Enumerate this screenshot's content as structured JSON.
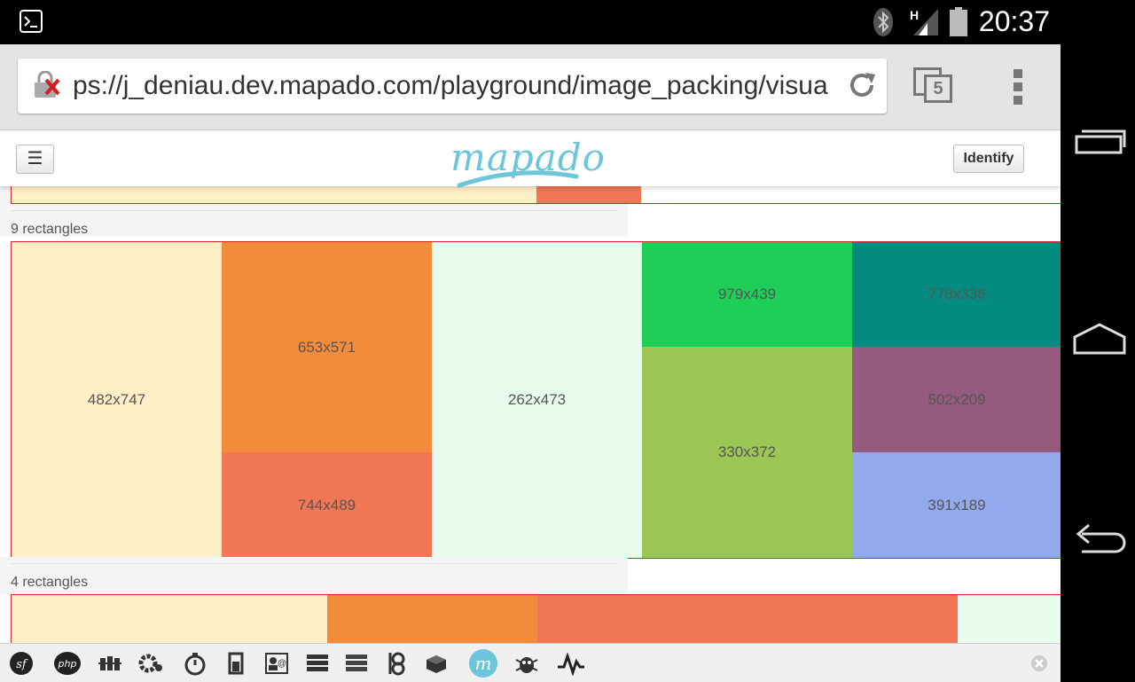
{
  "status_bar": {
    "clock": "20:37",
    "network_label": "H",
    "icons": [
      "terminal-icon",
      "bluetooth-icon",
      "signal-icon",
      "battery-icon"
    ]
  },
  "browser": {
    "url": "ps://j_deniau.dev.mapado.com/playground/image_packing/visua",
    "tab_count": "5",
    "icons": [
      "insecure-lock-icon",
      "reload-icon",
      "tabs-icon",
      "overflow-menu-icon"
    ]
  },
  "site_header": {
    "logo_text": "mapado",
    "identify_label": "Identify",
    "menu_icon": "hamburger-icon"
  },
  "sections": [
    {
      "label": "9 rectangles",
      "rects": [
        {
          "label": "482x747",
          "color": "#ffefc7"
        },
        {
          "label": "653x571",
          "color": "#f48d3b"
        },
        {
          "label": "744x489",
          "color": "#f27754"
        },
        {
          "label": "262x473",
          "color": "#e8fdee"
        },
        {
          "label": "979x439",
          "color": "#1ece56"
        },
        {
          "label": "330x372",
          "color": "#9cc755"
        },
        {
          "label": "778x336",
          "color": "#048b80"
        },
        {
          "label": "502x209",
          "color": "#955b7e"
        },
        {
          "label": "391x189",
          "color": "#93a9ee"
        }
      ]
    },
    {
      "label": "4 rectangles",
      "rects": [
        {
          "label": "",
          "color": "#ffefc7"
        },
        {
          "label": "",
          "color": "#f48d3b"
        },
        {
          "label": "",
          "color": "#f27754"
        },
        {
          "label": "",
          "color": "#e8fdee"
        }
      ]
    }
  ],
  "previous_section_rects": [
    {
      "color": "#ffefc7"
    },
    {
      "color": "#f27754"
    }
  ],
  "debug_toolbar": {
    "icons": [
      "symfony-icon",
      "php-icon",
      "request-icon",
      "config-icon",
      "timer-icon",
      "memory-icon",
      "user-icon",
      "logs-icon",
      "events-icon",
      "twig-icon",
      "database-icon",
      "mapado-icon",
      "security-icon",
      "performance-icon",
      "close-toolbar-icon"
    ]
  },
  "android_nav": {
    "icons": [
      "recents-icon",
      "home-icon",
      "back-icon"
    ]
  }
}
